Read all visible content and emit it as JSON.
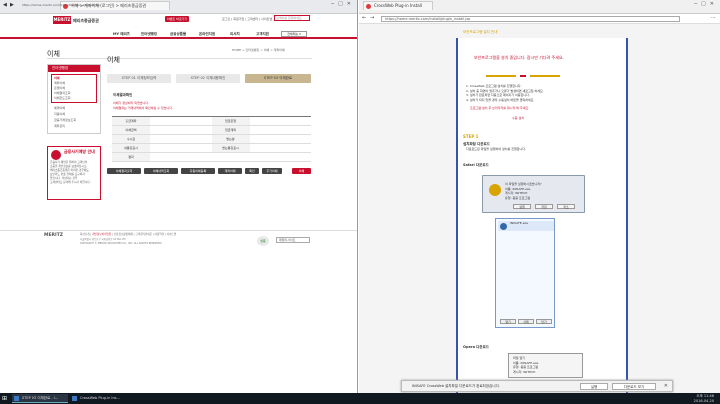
{
  "left_window": {
    "tab_title": "이체 > 계좌이체 (로그인) > 메리츠종금증권",
    "address": "https://home.meritz.com/trade/transfer_account.jsp",
    "brand": {
      "logo": "MERITZ",
      "name": "메리츠종금증권"
    },
    "top_button": "이벤트 바로가기",
    "top_links": "로그인 | 회원가입 | 고객센터 | 사이트맵",
    "search_placeholder": "검색어를 입력하세요",
    "gnb": [
      "MY 메리츠",
      "인터넷뱅킹",
      "금융상품몰",
      "온라인지점",
      "리서치",
      "고객지원",
      "증권정보"
    ],
    "gnb_button": "전체메뉴 ▾",
    "page_title": "이체",
    "breadcrumb": "HOME > 인터넷뱅킹 > 이체 > 계좌이체",
    "sidebar": {
      "header": "인터넷뱅킹",
      "active": "이체",
      "sub_items": [
        "계좌이체",
        "은행이체",
        "이체결과조회",
        "이체한도조회"
      ],
      "items": [
        "예약이체",
        "자동이체",
        "금융거래정보조회",
        "계좌관리"
      ]
    },
    "ad": {
      "title": "금융사기예방 안내",
      "lines": [
        "금융사기 예방을 위하여 고객님의",
        "소중한 개인정보를 보호하십시오.",
        "메리츠종금증권은 어떠한 경우에도",
        "보안카드 번호 전체를 요구하지",
        "않습니다. 의심되는 경우",
        "고객센터로 문의해 주시기 바랍니다."
      ]
    },
    "main_title": "이체",
    "steps": [
      "STEP 01  이체정보입력",
      "STEP 02  이체내용확인",
      "STEP 03  이체완료"
    ],
    "section_title": "이체결과확인",
    "warnings": [
      "이체가 정상처리 되었습니다.",
      "이체결과는 거래내역에서 확인하실 수 있습니다."
    ],
    "table": [
      [
        "출금계좌",
        "",
        "입금은행",
        ""
      ],
      [
        "이체금액",
        "",
        "입금계좌",
        ""
      ],
      [
        "수수료",
        "",
        "받는분",
        ""
      ],
      [
        "내통장표시",
        "",
        "받는통장표시",
        ""
      ],
      [
        "결과",
        "",
        "",
        ""
      ]
    ],
    "actions": [
      "이체결과출력",
      "이체내역조회",
      "자동이체등록",
      "계좌이체",
      "확인",
      "추가이체",
      "이체"
    ],
    "footer": {
      "logo": "MERITZ",
      "links": [
        "회사소개",
        "개인정보처리방침",
        "신용정보활용체제",
        "고객권리안내문",
        "이용약관",
        "사이트맵"
      ],
      "address_lines": [
        "서울특별시 영등포구 국제금융로 10 Two IFC",
        "COPYRIGHT © MERITZ SECURITIES CO., LTD. ALL RIGHTS RESERVED."
      ],
      "badge": "인증",
      "select": "패밀리사이트"
    }
  },
  "right_window": {
    "tab_title": "CrossWeb Plug-in Install",
    "address": "https://home.meritz.com/install/plugin_install.jsp",
    "header": "보안프로그램 설치 안내",
    "notice_title": "보안프로그램을 설치 중입니다. 잠시만 기다려 주세요.",
    "info_lines": [
      "1. CrossWeb 프로그램 설치를 진행합니다.",
      "2. 설치 중 화면이 멈추거나 오류가 발생하면 새로고침 하세요.",
      "3. 설치가 완료되면 자동으로 페이지가 이동합니다.",
      "4. 설치가 되지 않을 경우 수동설치 버튼을 클릭하세요."
    ],
    "highlight": "프로그램 설치 후 브라우저를 재시작 해 주세요.",
    "sub_note": "수동 설치",
    "step_mark": "STEP 1",
    "step_desc": [
      "설치파일 다운로드",
      "다운로드된 파일을 실행하여 설치를 진행합니다."
    ],
    "safari_label": "Safari 다운로드",
    "dialog": {
      "lines": [
        "이 파일을 실행하시겠습니까?",
        "이름: INISAFE.exe",
        "게시자: INITECH",
        "유형: 응용 프로그램"
      ],
      "buttons": [
        "실행",
        "저장",
        "취소"
      ]
    },
    "list_item": "INISAFE.exe",
    "list_buttons": [
      "열기",
      "삭제",
      "닫기"
    ],
    "opera_label": "Opera 다운로드",
    "dialog2": [
      "파일 열기",
      "이름: INISAFE.exe",
      "유형: 응용 프로그램",
      "게시자: INITECH"
    ],
    "notification": {
      "text": "INISAFE CrossWeb 설치파일 다운로드가 완료되었습니다.",
      "buttons": [
        "실행",
        "다운로드 보기"
      ]
    }
  },
  "taskbar": {
    "items": [
      "STEP 03 이체완료 - I...",
      "CrossWeb Plug-in Ins..."
    ],
    "time": "오후 11:46",
    "date": "2016-04-20"
  },
  "colors": {
    "brand": "#c8102e",
    "accent": "#d9a300",
    "frame": "#3355aa"
  }
}
